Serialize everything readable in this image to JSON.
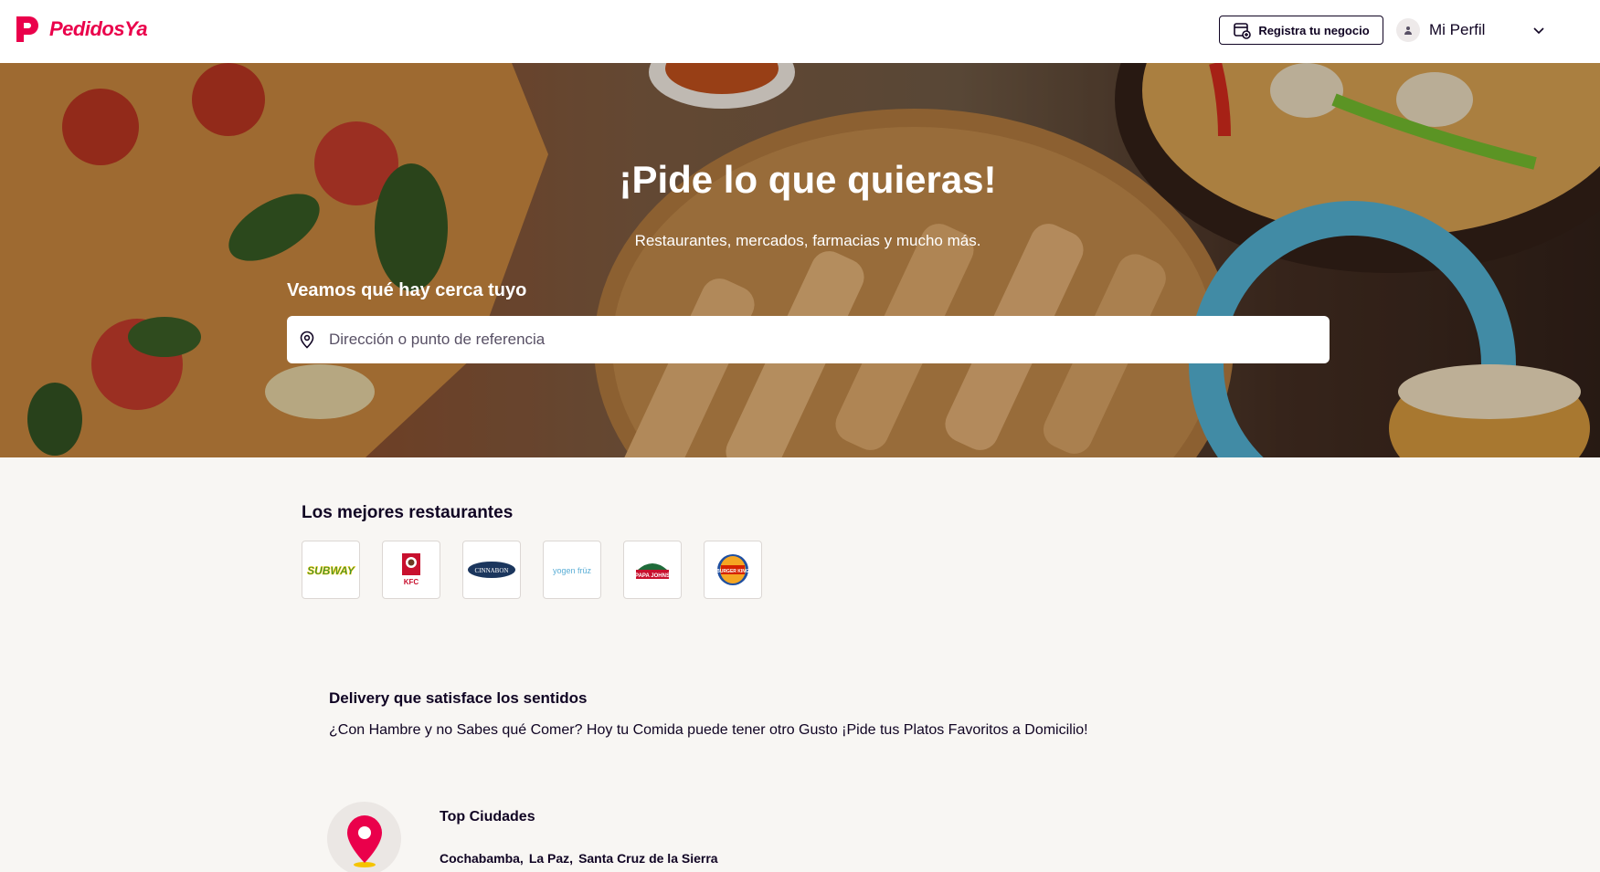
{
  "header": {
    "brand": "PedidosYa",
    "register_business_label": "Registra tu negocio",
    "profile_label": "Mi Perfil"
  },
  "hero": {
    "title": "¡Pide lo que quieras!",
    "subtitle": "Restaurantes, mercados, farmacias y mucho más.",
    "nearby_label": "Veamos qué hay cerca tuyo",
    "search_placeholder": "Dirección o punto de referencia",
    "search_value": ""
  },
  "best_restaurants": {
    "title": "Los mejores restaurantes",
    "brands": [
      {
        "logo_text": "SUBWAY",
        "icon": "subway-logo"
      },
      {
        "logo_text": "KFC",
        "icon": "kfc-logo"
      },
      {
        "logo_text": "CINNABON",
        "icon": "cinnabon-logo"
      },
      {
        "logo_text": "yogen früz",
        "icon": "yogen-fruz-logo"
      },
      {
        "logo_text": "PAPA JOHNS",
        "icon": "papa-johns-logo"
      },
      {
        "logo_text": "BURGER KING",
        "icon": "burger-king-logo"
      }
    ]
  },
  "delivery": {
    "title": "Delivery que satisface los sentidos",
    "text": "¿Con Hambre y no Sabes qué Comer? Hoy tu Comida puede tener otro Gusto ¡Pide tus Platos Favoritos a Domicilio!"
  },
  "top_cities": {
    "title": "Top Ciudades",
    "cities": [
      "Cochabamba",
      "La Paz",
      "Santa Cruz de la Sierra"
    ],
    "icon": "map-pin-icon"
  },
  "colors": {
    "brand": "#ea004b",
    "text": "#100423",
    "page_bg": "#f8f6f3"
  }
}
